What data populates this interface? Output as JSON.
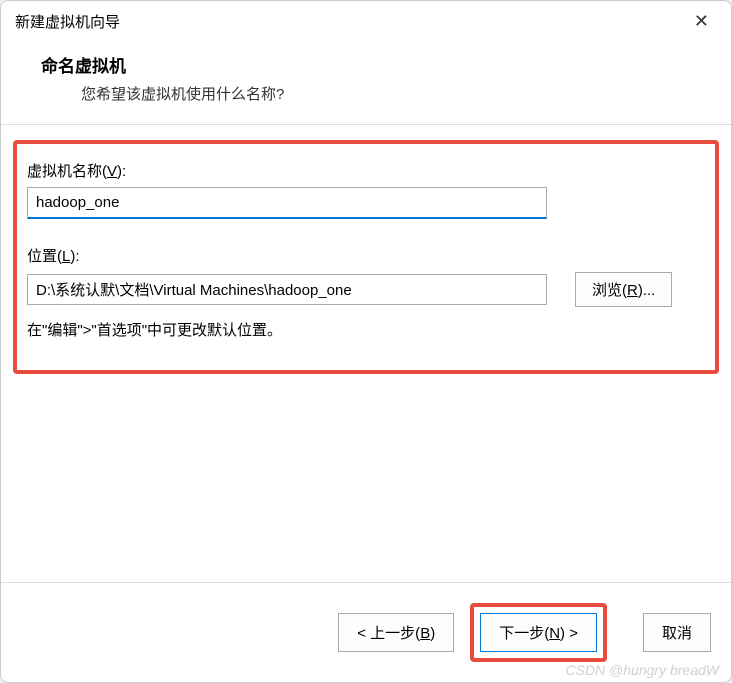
{
  "dialog": {
    "title": "新建虚拟机向导"
  },
  "header": {
    "title": "命名虚拟机",
    "subtitle": "您希望该虚拟机使用什么名称?"
  },
  "form": {
    "name_label_pre": "虚拟机名称(",
    "name_label_key": "V",
    "name_label_post": "):",
    "name_value": "hadoop_one",
    "location_label_pre": "位置(",
    "location_label_key": "L",
    "location_label_post": "):",
    "location_value": "D:\\系统认默\\文档\\Virtual Machines\\hadoop_one",
    "browse_label_pre": "浏览(",
    "browse_label_key": "R",
    "browse_label_post": ")...",
    "hint": "在\"编辑\">\"首选项\"中可更改默认位置。"
  },
  "footer": {
    "back_pre": "< 上一步(",
    "back_key": "B",
    "back_post": ")",
    "next_pre": "下一步(",
    "next_key": "N",
    "next_post": ") >",
    "cancel": "取消"
  },
  "watermark": "CSDN @hungry breadW"
}
